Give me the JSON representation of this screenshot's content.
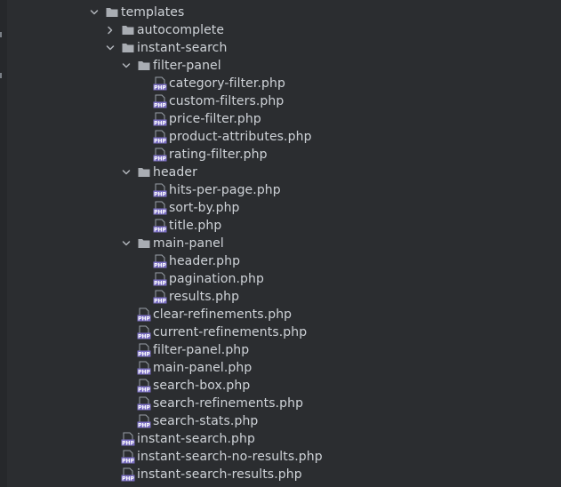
{
  "tree": [
    {
      "label": "templates",
      "type": "folder",
      "depth": 0,
      "expanded": true
    },
    {
      "label": "autocomplete",
      "type": "folder",
      "depth": 1,
      "expanded": false
    },
    {
      "label": "instant-search",
      "type": "folder",
      "depth": 1,
      "expanded": true
    },
    {
      "label": "filter-panel",
      "type": "folder",
      "depth": 2,
      "expanded": true
    },
    {
      "label": "category-filter.php",
      "type": "php",
      "depth": 3
    },
    {
      "label": "custom-filters.php",
      "type": "php",
      "depth": 3
    },
    {
      "label": "price-filter.php",
      "type": "php",
      "depth": 3
    },
    {
      "label": "product-attributes.php",
      "type": "php",
      "depth": 3
    },
    {
      "label": "rating-filter.php",
      "type": "php",
      "depth": 3
    },
    {
      "label": "header",
      "type": "folder",
      "depth": 2,
      "expanded": true
    },
    {
      "label": "hits-per-page.php",
      "type": "php",
      "depth": 3
    },
    {
      "label": "sort-by.php",
      "type": "php",
      "depth": 3
    },
    {
      "label": "title.php",
      "type": "php",
      "depth": 3
    },
    {
      "label": "main-panel",
      "type": "folder",
      "depth": 2,
      "expanded": true
    },
    {
      "label": "header.php",
      "type": "php",
      "depth": 3
    },
    {
      "label": "pagination.php",
      "type": "php",
      "depth": 3
    },
    {
      "label": "results.php",
      "type": "php",
      "depth": 3
    },
    {
      "label": "clear-refinements.php",
      "type": "php",
      "depth": 2
    },
    {
      "label": "current-refinements.php",
      "type": "php",
      "depth": 2
    },
    {
      "label": "filter-panel.php",
      "type": "php",
      "depth": 2
    },
    {
      "label": "main-panel.php",
      "type": "php",
      "depth": 2
    },
    {
      "label": "search-box.php",
      "type": "php",
      "depth": 2
    },
    {
      "label": "search-refinements.php",
      "type": "php",
      "depth": 2
    },
    {
      "label": "search-stats.php",
      "type": "php",
      "depth": 2
    },
    {
      "label": "instant-search.php",
      "type": "php",
      "depth": 1
    },
    {
      "label": "instant-search-no-results.php",
      "type": "php",
      "depth": 1
    },
    {
      "label": "instant-search-results.php",
      "type": "php",
      "depth": 1
    }
  ],
  "colors": {
    "background": "#2b2d30",
    "text": "#cfd3d8",
    "folder": "#a9adb3",
    "php_badge": "#7b6fc4",
    "arrow": "#b0b4ba"
  },
  "icons": {
    "folder": "folder-icon",
    "php": "php-file-icon",
    "expanded": "chevron-down-icon",
    "collapsed": "chevron-right-icon"
  }
}
